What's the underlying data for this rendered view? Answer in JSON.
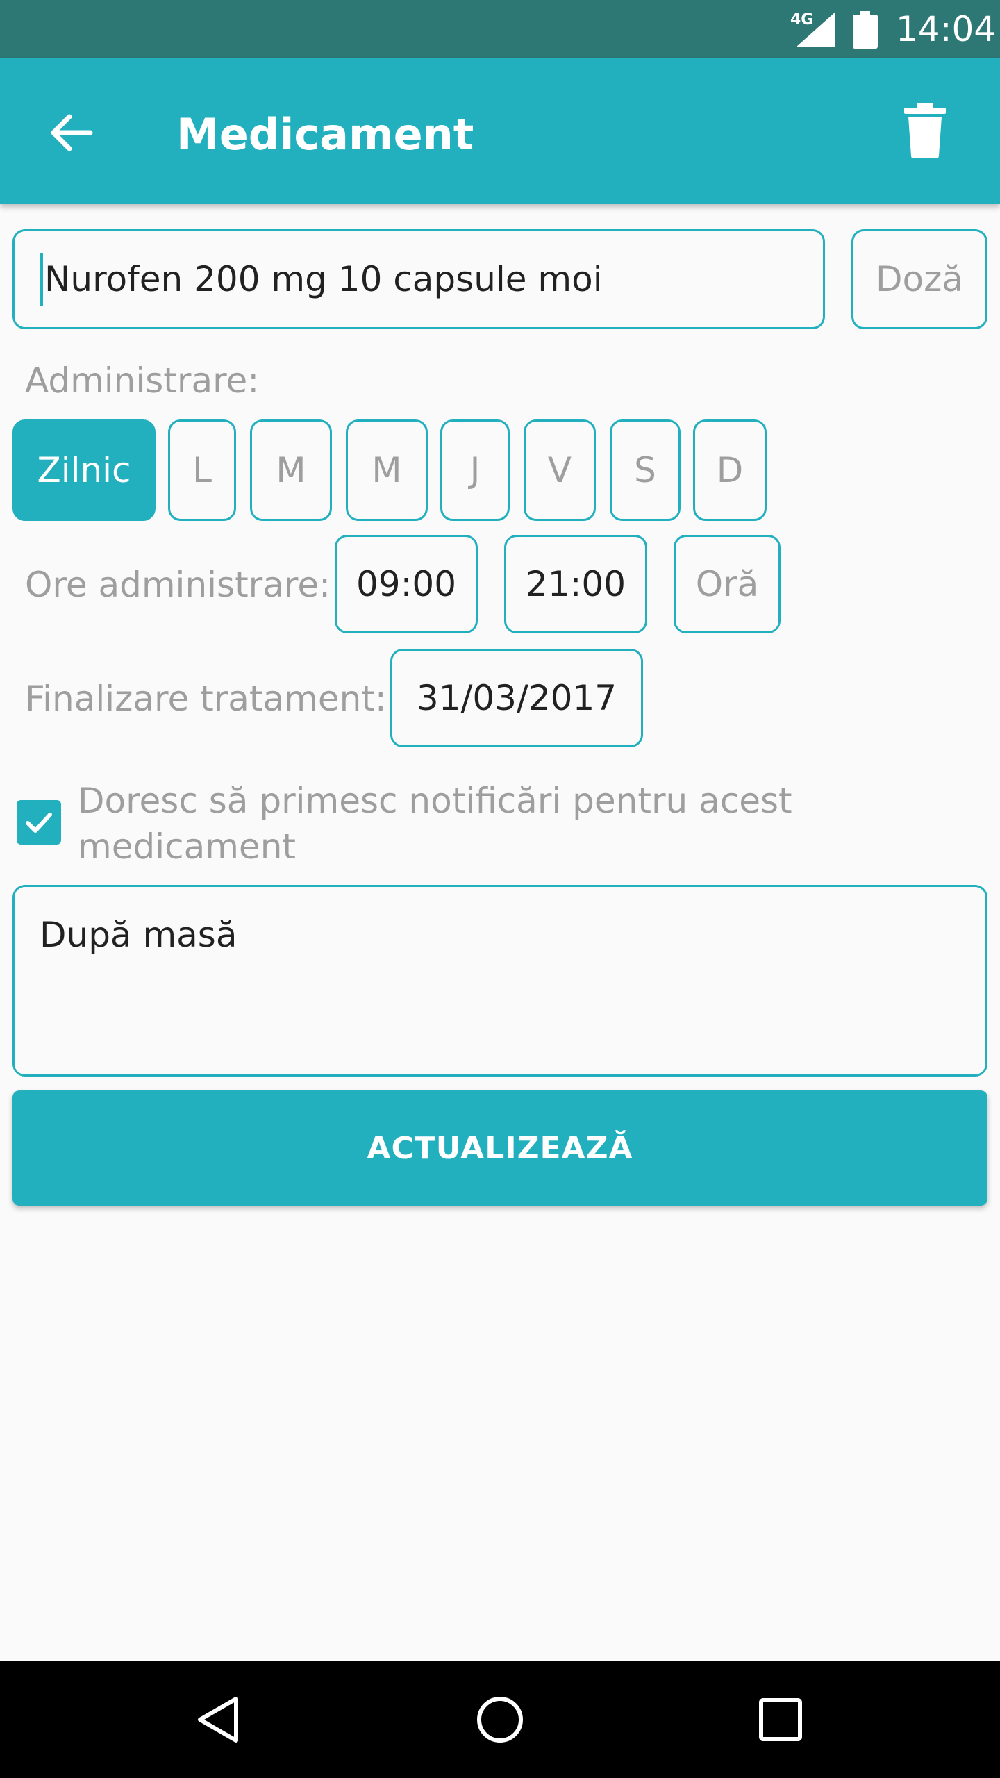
{
  "status_bar": {
    "network": "4G",
    "time": "14:04"
  },
  "app_bar": {
    "title": "Medicament"
  },
  "medication": {
    "name": "Nurofen 200 mg 10 capsule moi",
    "dose_placeholder": "Doză"
  },
  "schedule": {
    "administration_label": "Administrare:",
    "days": [
      "Zilnic",
      "L",
      "M",
      "M",
      "J",
      "V",
      "S",
      "D"
    ],
    "selected_day": "Zilnic",
    "hours_label": "Ore administrare:",
    "hours": [
      "09:00",
      "21:00"
    ],
    "hour_placeholder": "Oră",
    "end_label": "Finalizare tratament:",
    "end_date": "31/03/2017"
  },
  "notifications": {
    "checked": true,
    "label": "Doresc să primesc notificări pentru acest medicament"
  },
  "notes": {
    "value": "După masă"
  },
  "update_button": {
    "label": "ACTUALIZEAZĂ"
  },
  "colors": {
    "accent": "#22b0bf",
    "status_bar": "#2d7875",
    "hint": "#9e9e9e"
  }
}
